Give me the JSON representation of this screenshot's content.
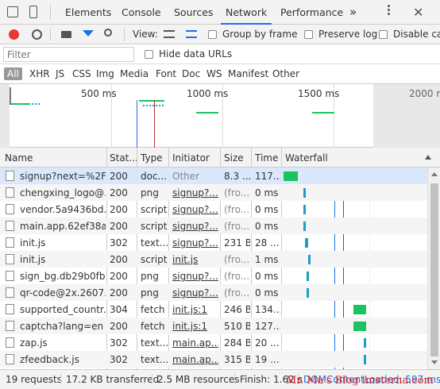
{
  "tabs": [
    "Elements",
    "Console",
    "Sources",
    "Network",
    "Performance"
  ],
  "more_tabs": "»",
  "toolbar": {
    "view_label": "View:",
    "group_by_frame": "Group by frame",
    "preserve_log": "Preserve log",
    "disable_cache": "Disable cac"
  },
  "filter": {
    "placeholder": "Filter",
    "hide_data_urls": "Hide data URLs"
  },
  "types": [
    "All",
    "XHR",
    "JS",
    "CSS",
    "Img",
    "Media",
    "Font",
    "Doc",
    "WS",
    "Manifest",
    "Other"
  ],
  "overview_ticks": [
    "500 ms",
    "1000 ms",
    "1500 ms",
    "2000 ms"
  ],
  "columns": [
    "Name",
    "Stat...",
    "Type",
    "Initiator",
    "Size",
    "Time",
    "Waterfall"
  ],
  "rows": [
    {
      "name": "signup?next=%2F",
      "status": "200",
      "type": "doc...",
      "initiator": "Other",
      "size": "8.3 ...",
      "time": "117..."
    },
    {
      "name": "chengxing_logo@...",
      "status": "200",
      "type": "png",
      "initiator": "signup?...",
      "size": "(fro...",
      "time": "0 ms"
    },
    {
      "name": "vendor.5a9436bd...",
      "status": "200",
      "type": "script",
      "initiator": "signup?...",
      "size": "(fro...",
      "time": "0 ms"
    },
    {
      "name": "main.app.62ef38a...",
      "status": "200",
      "type": "script",
      "initiator": "signup?...",
      "size": "(fro...",
      "time": "0 ms"
    },
    {
      "name": "init.js",
      "status": "302",
      "type": "text...",
      "initiator": "signup?...",
      "size": "231 B",
      "time": "28 ..."
    },
    {
      "name": "init.js",
      "status": "200",
      "type": "script",
      "initiator": "init.js",
      "size": "(fro...",
      "time": "1 ms"
    },
    {
      "name": "sign_bg.db29b0fb...",
      "status": "200",
      "type": "png",
      "initiator": "signup?...",
      "size": "(fro...",
      "time": "0 ms"
    },
    {
      "name": "qr-code@2x.2607...",
      "status": "200",
      "type": "png",
      "initiator": "signup?...",
      "size": "(fro...",
      "time": "0 ms"
    },
    {
      "name": "supported_countr...",
      "status": "304",
      "type": "fetch",
      "initiator": "init.js:1",
      "size": "246 B",
      "time": "134..."
    },
    {
      "name": "captcha?lang=en",
      "status": "200",
      "type": "fetch",
      "initiator": "init.js:1",
      "size": "510 B",
      "time": "127..."
    },
    {
      "name": "zap.js",
      "status": "302",
      "type": "text...",
      "initiator": "main.ap...",
      "size": "284 B",
      "time": "20 ..."
    },
    {
      "name": "zfeedback.js",
      "status": "302",
      "type": "text...",
      "initiator": "main.ap...",
      "size": "315 B",
      "time": "19 ..."
    }
  ],
  "waterfall": [
    {
      "start": 0,
      "end": 0.1,
      "color": "#19c460"
    },
    {
      "start": 0.14,
      "end": 0.145,
      "color": "#18a0c8"
    },
    {
      "start": 0.14,
      "end": 0.145,
      "color": "#18a0c8"
    },
    {
      "start": 0.14,
      "end": 0.145,
      "color": "#18a0c8"
    },
    {
      "start": 0.15,
      "end": 0.17,
      "color": "#18a0c8"
    },
    {
      "start": 0.17,
      "end": 0.175,
      "color": "#18a0c8"
    },
    {
      "start": 0.16,
      "end": 0.165,
      "color": "#18a0c8"
    },
    {
      "start": 0.16,
      "end": 0.165,
      "color": "#18a0c8"
    },
    {
      "start": 0.49,
      "end": 0.58,
      "color": "#19c460"
    },
    {
      "start": 0.49,
      "end": 0.58,
      "color": "#19c460"
    },
    {
      "start": 0.56,
      "end": 0.58,
      "color": "#18a0c8"
    },
    {
      "start": 0.56,
      "end": 0.58,
      "color": "#18a0c8"
    }
  ],
  "status_bar": {
    "requests": "19 requests",
    "transferred": "17.2 KB transferred",
    "resources": "2.5 MB resources",
    "finish": "Finish: 1.62 s",
    "dcl": "DOMContentLoaded: 597 ms"
  },
  "watermark": "Mr. Ma's Blog  imsterna.com",
  "colors": {
    "accent": "#1a73e8",
    "record": "#e53935",
    "dcl_line": "#1a73e8",
    "load_line": "#b03030",
    "selected_row": "#dae8fb"
  }
}
